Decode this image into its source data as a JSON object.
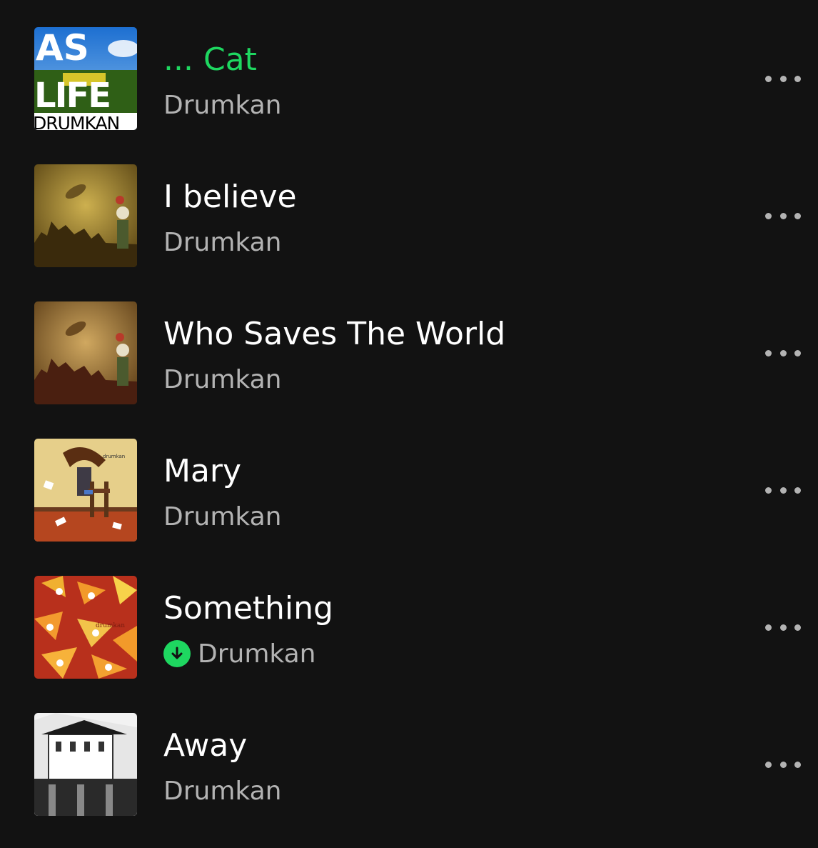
{
  "tracks": [
    {
      "title": "... Cat",
      "artist": "Drumkan",
      "playing": true,
      "downloaded": false,
      "art_text": [
        "AS",
        "LIFE",
        "DRUMKAN"
      ]
    },
    {
      "title": "I believe",
      "artist": "Drumkan",
      "playing": false,
      "downloaded": false
    },
    {
      "title": "Who Saves The World",
      "artist": "Drumkan",
      "playing": false,
      "downloaded": false
    },
    {
      "title": "Mary",
      "artist": "Drumkan",
      "playing": false,
      "downloaded": false,
      "art_text": [
        "drumkan"
      ]
    },
    {
      "title": "Something",
      "artist": "Drumkan",
      "playing": false,
      "downloaded": true,
      "art_text": [
        "drumkan"
      ]
    },
    {
      "title": "Away",
      "artist": "Drumkan",
      "playing": false,
      "downloaded": false
    }
  ],
  "colors": {
    "background": "#121212",
    "accent": "#1ed760",
    "secondary_text": "#b3b3b3"
  },
  "icons": {
    "download": "download-arrow-icon",
    "more": "more-options-icon"
  }
}
